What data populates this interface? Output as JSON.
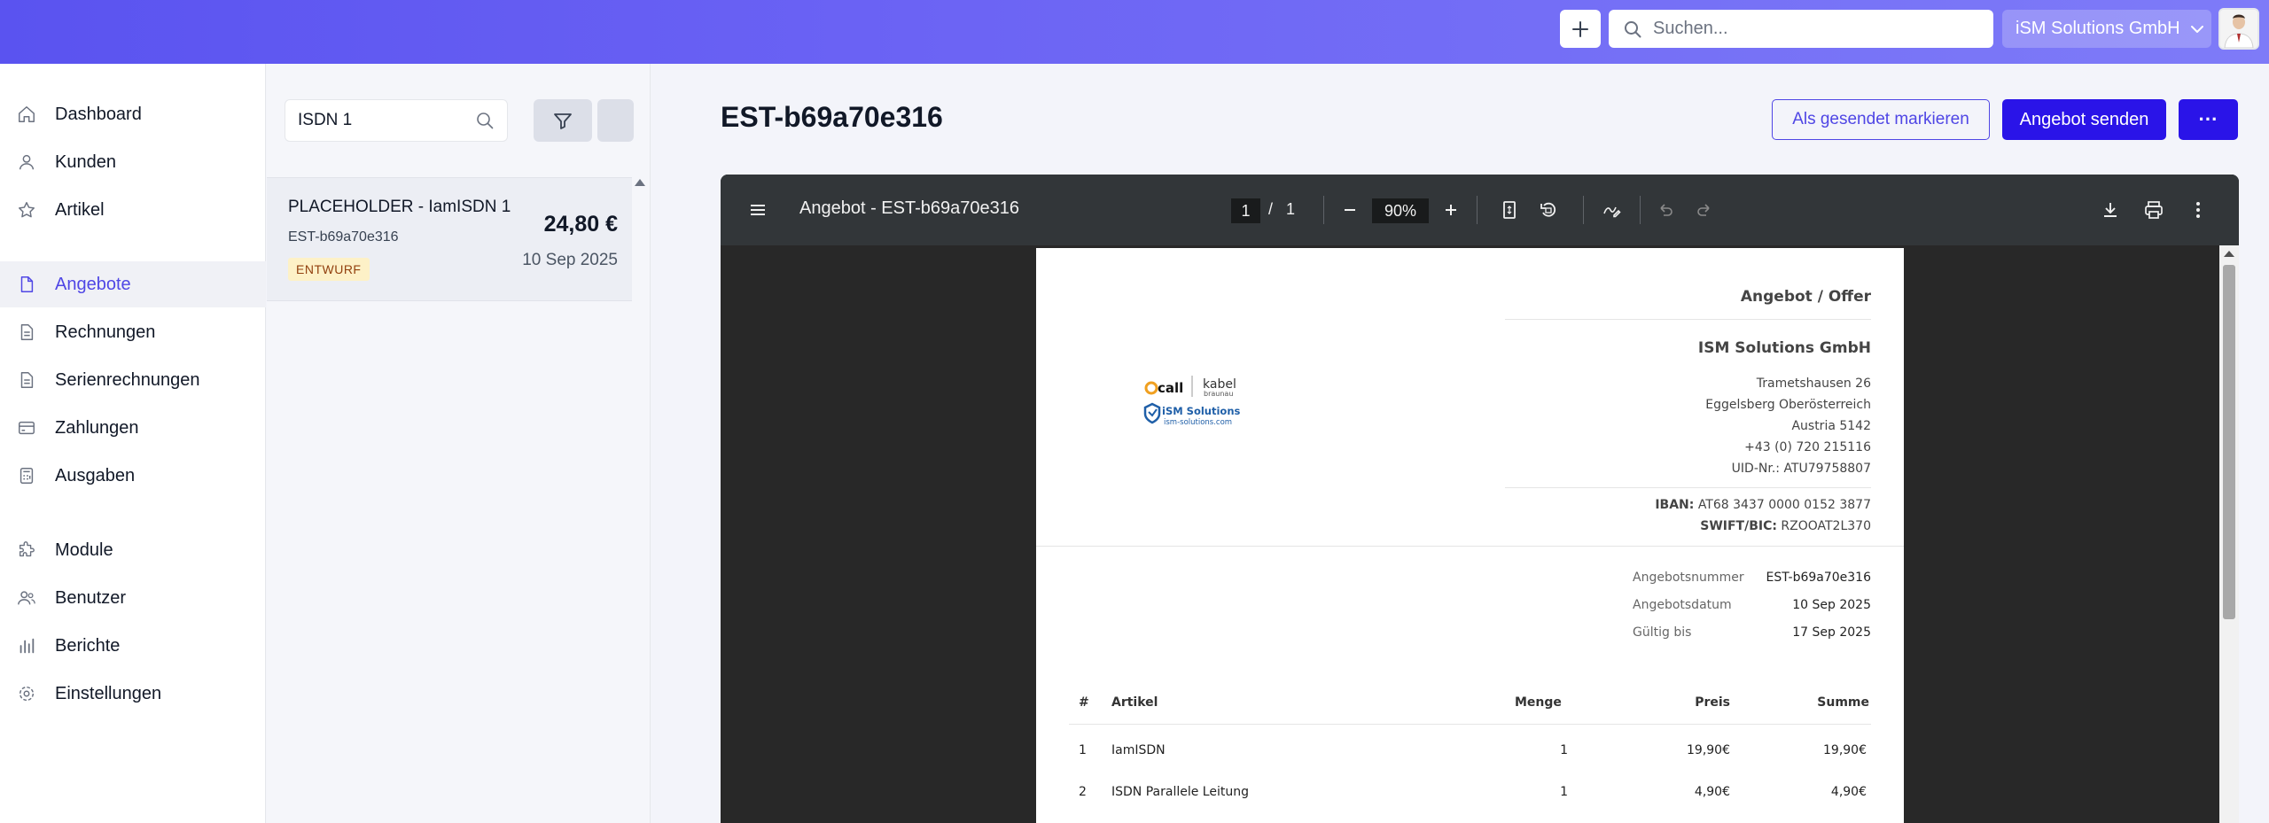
{
  "topbar": {
    "search_placeholder": "Suchen...",
    "company": "iSM Solutions GmbH"
  },
  "sidebar": {
    "items": [
      {
        "label": "Dashboard",
        "icon": "home-icon"
      },
      {
        "label": "Kunden",
        "icon": "user-icon"
      },
      {
        "label": "Artikel",
        "icon": "star-icon"
      },
      {
        "label": "Angebote",
        "icon": "document-icon",
        "active": true
      },
      {
        "label": "Rechnungen",
        "icon": "invoice-icon"
      },
      {
        "label": "Serienrechnungen",
        "icon": "invoice-icon"
      },
      {
        "label": "Zahlungen",
        "icon": "credit-card-icon"
      },
      {
        "label": "Ausgaben",
        "icon": "calculator-icon"
      },
      {
        "label": "Module",
        "icon": "puzzle-icon"
      },
      {
        "label": "Benutzer",
        "icon": "users-icon"
      },
      {
        "label": "Berichte",
        "icon": "bar-chart-icon"
      },
      {
        "label": "Einstellungen",
        "icon": "gear-icon"
      }
    ]
  },
  "list": {
    "search_value": "ISDN 1",
    "card": {
      "title": "PLACEHOLDER - IamISDN 1",
      "number": "EST-b69a70e316",
      "amount": "24,80 €",
      "date": "10 Sep 2025",
      "status": "ENTWURF"
    }
  },
  "main": {
    "title": "EST-b69a70e316",
    "mark_sent_label": "Als gesendet markieren",
    "send_label": "Angebot senden",
    "more_label": "···"
  },
  "viewer": {
    "doc_title": "Angebot - EST-b69a70e316",
    "page_current": "1",
    "page_sep": "/",
    "page_total": "1",
    "zoom": "90%"
  },
  "pdf": {
    "heading": "Angebot / Offer",
    "company": "ISM Solutions GmbH",
    "address": [
      "Trametshausen 26",
      "Eggelsberg Oberösterreich",
      "Austria 5142",
      "+43 (0) 720 215116",
      "UID-Nr.: ATU79758807"
    ],
    "iban_label": "IBAN:",
    "iban": "AT68 3437 0000 0152 3877",
    "swift_label": "SWIFT/BIC:",
    "swift": "RZOOAT2L370",
    "meta": [
      {
        "label": "Angebotsnummer",
        "value": "EST-b69a70e316"
      },
      {
        "label": "Angebotsdatum",
        "value": "10 Sep 2025"
      },
      {
        "label": "Gültig bis",
        "value": "17 Sep 2025"
      }
    ],
    "table_headers": [
      "#",
      "Artikel",
      "Menge",
      "Preis",
      "Summe"
    ],
    "rows": [
      {
        "num": "1",
        "artikel": "IamISDN",
        "menge": "1",
        "preis": "19,90€",
        "summe": "19,90€"
      },
      {
        "num": "2",
        "artikel": "ISDN Parallele Leitung",
        "menge": "1",
        "preis": "4,90€",
        "summe": "4,90€"
      }
    ],
    "logo": {
      "brand1": "call",
      "brand2": "kabel",
      "brand2_sub": "braunau",
      "brand3": "iSM Solutions",
      "brand3_url": "ism-solutions.com"
    }
  }
}
